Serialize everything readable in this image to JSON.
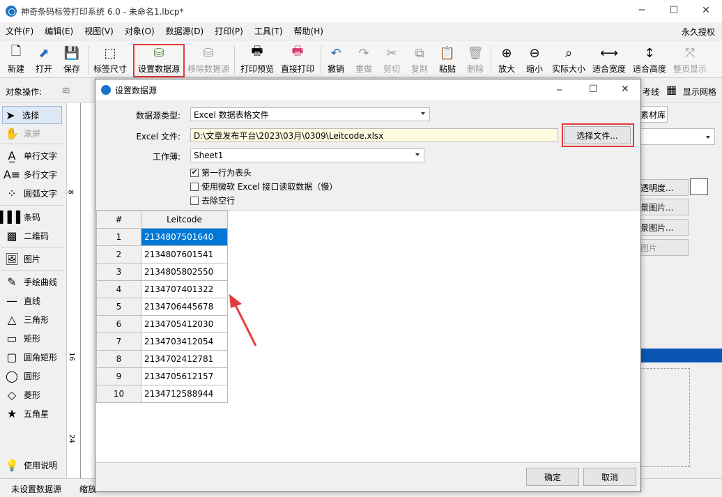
{
  "app": {
    "title": "神奇条码标签打印系统 6.0 - 未命名1.lbcp*"
  },
  "menu": [
    "文件(F)",
    "编辑(E)",
    "视图(V)",
    "对象(O)",
    "数据源(D)",
    "打印(P)",
    "工具(T)",
    "帮助(H)"
  ],
  "menu_right": "永久授权",
  "toolbar": [
    "新建",
    "打开",
    "保存",
    "标签尺寸",
    "设置数据源",
    "移除数据源",
    "打印预览",
    "直接打印",
    "撤销",
    "重做",
    "剪切",
    "复制",
    "粘贴",
    "删除",
    "放大",
    "缩小",
    "实际大小",
    "适合宽度",
    "适合高度",
    "整页显示"
  ],
  "objbar": {
    "label": "对象操作:",
    "reference_line": "考线",
    "show_grid": "显示网格"
  },
  "leftpanel": [
    "选择",
    "滚屏",
    "单行文字",
    "多行文字",
    "圆弧文字",
    "条码",
    "二维码",
    "图片",
    "手绘曲线",
    "直线",
    "三角形",
    "矩形",
    "圆角矩形",
    "圆形",
    "菱形",
    "五角星",
    "使用说明"
  ],
  "rightpanel": {
    "tab": "素材库",
    "buttons": [
      "透明度...",
      "景图片...",
      "景图片...",
      "图片"
    ]
  },
  "ruler_marks": [
    "8",
    "16",
    "24"
  ],
  "status": {
    "datasource": "未设置数据源",
    "zoom": "缩放"
  },
  "dialog": {
    "title": "设置数据源",
    "type_label": "数据源类型:",
    "type_value": "Excel 数据表格文件",
    "file_label": "Excel 文件:",
    "file_value": "D:\\文章发布平台\\2023\\03月\\0309\\Leitcode.xlsx",
    "choose_file": "选择文件...",
    "sheet_label": "工作薄:",
    "sheet_value": "Sheet1",
    "opt_header": "第一行为表头",
    "opt_ms": "使用微软 Excel 接口读取数据（慢）",
    "opt_blank": "去除空行",
    "col_index": "#",
    "col_name": "Leitcode",
    "rows": [
      {
        "n": "1",
        "v": "2134807501640"
      },
      {
        "n": "2",
        "v": "2134807601541"
      },
      {
        "n": "3",
        "v": "2134805802550"
      },
      {
        "n": "4",
        "v": "2134707401322"
      },
      {
        "n": "5",
        "v": "2134706445678"
      },
      {
        "n": "6",
        "v": "2134705412030"
      },
      {
        "n": "7",
        "v": "2134703412054"
      },
      {
        "n": "8",
        "v": "2134702412781"
      },
      {
        "n": "9",
        "v": "2134705612157"
      },
      {
        "n": "10",
        "v": "2134712588944"
      }
    ],
    "ok": "确定",
    "cancel": "取消"
  },
  "colors": {
    "accent": "#0078d7",
    "highlight": "#e23b3b",
    "path_bg": "#fffbe0"
  }
}
